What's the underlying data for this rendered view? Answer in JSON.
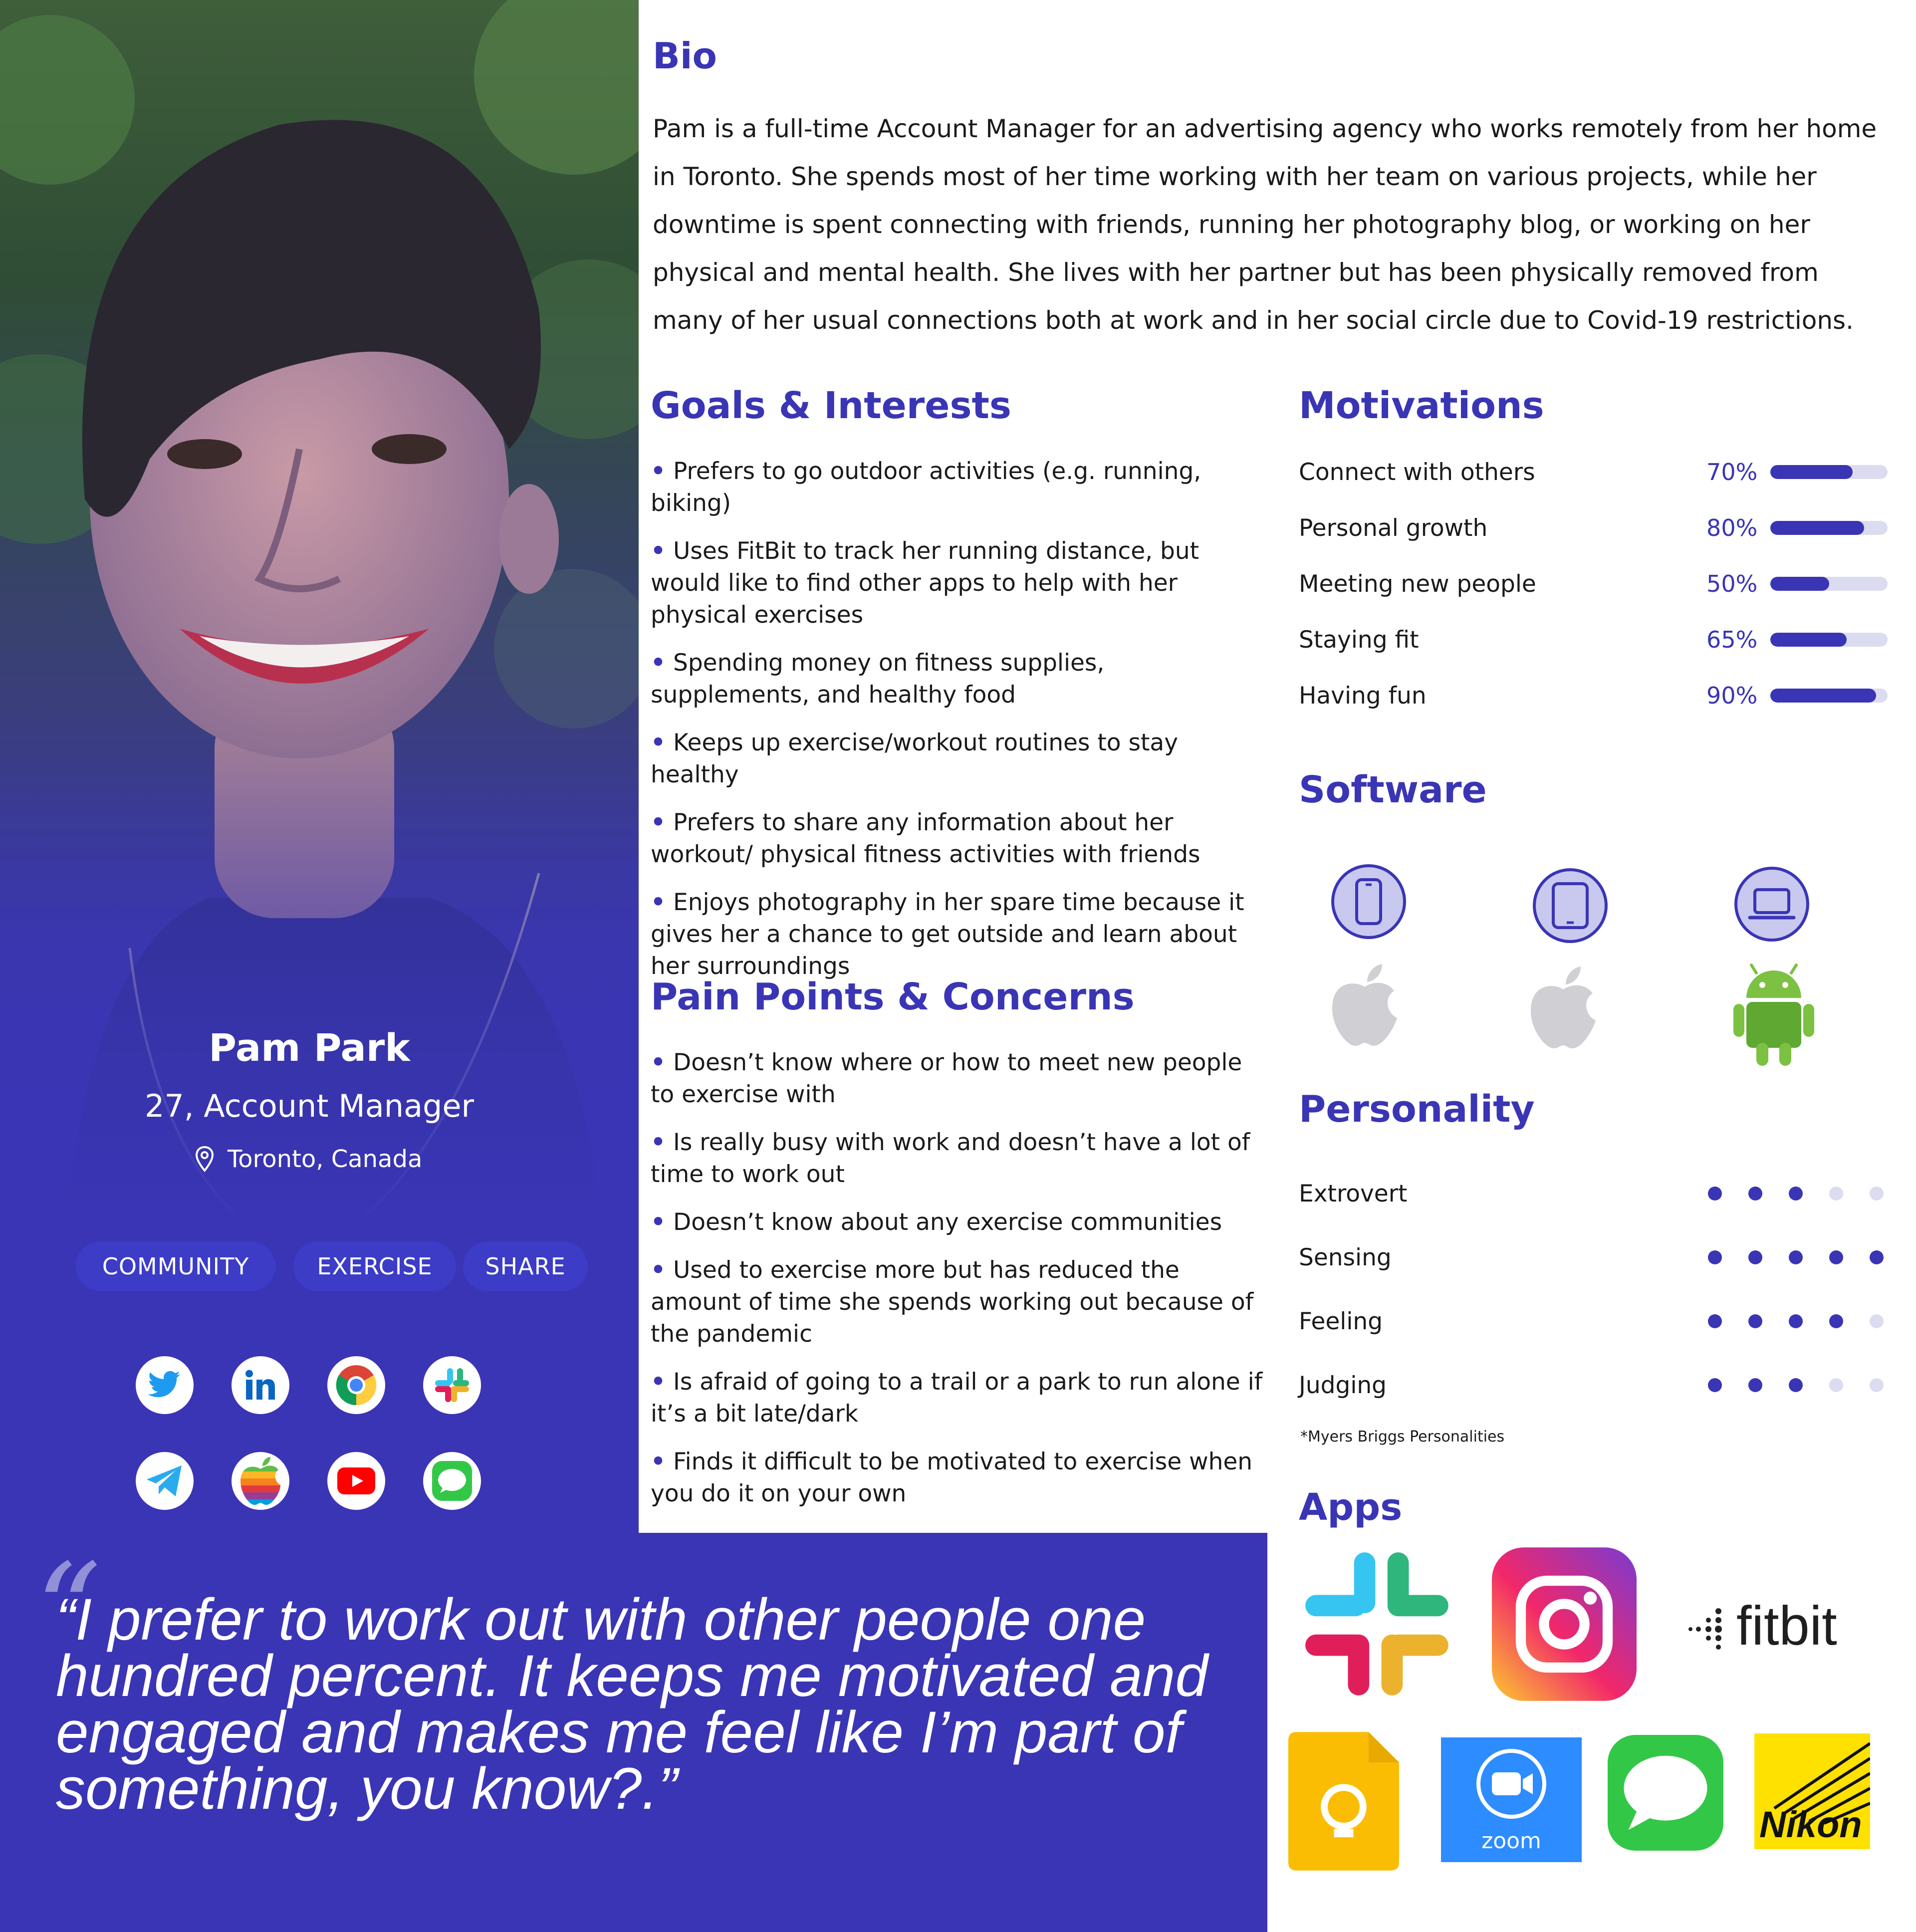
{
  "profile": {
    "name": "Pam Park",
    "role": "27, Account Manager",
    "location": "Toronto, Canada",
    "tags": [
      "COMMUNITY",
      "EXERCISE",
      "SHARE"
    ],
    "social_icons": [
      "twitter-icon",
      "linkedin-icon",
      "chrome-icon",
      "slack-icon",
      "telegram-icon",
      "apple-icon",
      "youtube-icon",
      "messages-icon"
    ]
  },
  "bio": {
    "title": "Bio",
    "text": "Pam is a full-time Account Manager for an advertising agency who works remotely from her home in Toronto. She spends most of her time working with her team on various projects, while her downtime is spent connecting with friends, running her photography blog, or working on her physical and mental health. She lives with her partner but has been physically removed from many of her usual connections both at work and in her social circle due to Covid-19 restrictions."
  },
  "goals": {
    "title": "Goals & Interests",
    "items": [
      "Prefers to go outdoor activities (e.g. running, biking)",
      "Uses FitBit to track her running distance, but would like to find other apps to help with her physical exercises",
      "Spending money on fitness supplies, supplements, and healthy food",
      "Keeps up exercise/workout routines to stay healthy",
      "Prefers to share any information about her workout/ physical fitness activities with friends",
      "Enjoys photography in her spare time because it gives her a chance to get outside and learn about her surroundings"
    ]
  },
  "pain": {
    "title": "Pain Points & Concerns",
    "items": [
      "Doesn’t know where or how to meet new people to exercise with",
      "Is really busy with work and doesn’t have a lot of time to work out",
      "Doesn’t know about any exercise communities",
      "Used to exercise more but has reduced the amount of time she spends working out because of the pandemic",
      "Is afraid of going to a trail or a park to run alone if it’s a bit late/dark",
      "Finds it difficult to be motivated to exercise when you do it on your own"
    ]
  },
  "motivations": {
    "title": "Motivations",
    "items": [
      {
        "label": "Connect with others",
        "value": "70%",
        "fraction": 0.7
      },
      {
        "label": "Personal growth",
        "value": "80%",
        "fraction": 0.8
      },
      {
        "label": "Meeting new people",
        "value": "50%",
        "fraction": 0.5
      },
      {
        "label": "Staying fit",
        "value": "65%",
        "fraction": 0.65
      },
      {
        "label": "Having fun",
        "value": "90%",
        "fraction": 0.9
      }
    ]
  },
  "software": {
    "title": "Software",
    "devices": [
      {
        "device": "phone-icon",
        "os": "apple-icon"
      },
      {
        "device": "tablet-icon",
        "os": "apple-icon"
      },
      {
        "device": "laptop-icon",
        "os": "android-icon"
      }
    ]
  },
  "personality": {
    "title": "Personality",
    "items": [
      {
        "label": "Extrovert",
        "level": 3,
        "max": 5
      },
      {
        "label": "Sensing",
        "level": 5,
        "max": 5
      },
      {
        "label": "Feeling",
        "level": 4,
        "max": 5
      },
      {
        "label": "Judging",
        "level": 3,
        "max": 5
      }
    ],
    "footnote": "*Myers Briggs Personalities"
  },
  "apps": {
    "title": "Apps",
    "icons": [
      "slack-icon",
      "instagram-icon",
      "fitbit-logo",
      "keynote-icon",
      "zoom-icon",
      "messages-icon",
      "nikon-logo"
    ],
    "fitbit_text": "fitbit",
    "zoom_text": "zoom",
    "nikon_text": "Nikon"
  },
  "quote": {
    "mark": "“",
    "text": "“I prefer to work out with other people one hundred percent. It keeps me motivated and engaged and makes me feel like I’m part of something, you know?.”"
  },
  "colors": {
    "accent": "#3a35b5",
    "track": "#dcdcf0"
  }
}
